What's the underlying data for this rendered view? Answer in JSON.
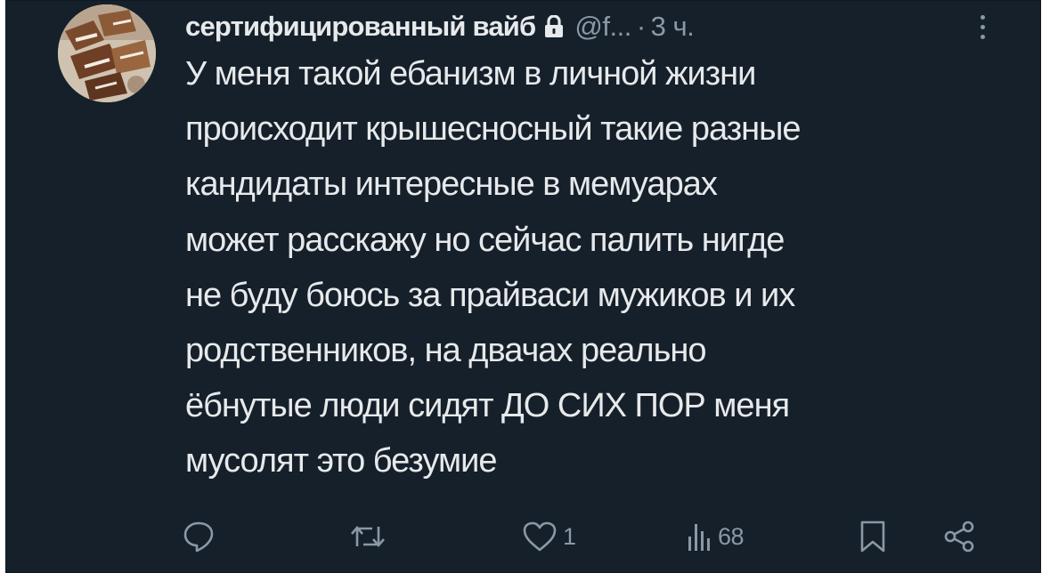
{
  "tweet": {
    "author_name": "сертифицированный вайб",
    "author_handle": "@f...",
    "separator": "·",
    "time": "3 ч.",
    "text": "У меня такой ебанизм в личной жизни\nпроисходит крышесносный такие разные\nкандидаты интересные в мемуарах\nможет расскажу но сейчас палить нигде\nне буду боюсь за прайваси мужиков и их\nродственников, на двачах реально\nёбнутые люди сидят ДО СИХ ПОР меня\nмусолят это безумие"
  },
  "icons": {
    "lock": "lock-icon",
    "more": "more-vertical-icon",
    "reply": "reply-icon",
    "retweet": "retweet-icon",
    "like": "heart-icon",
    "views": "views-chart-icon",
    "bookmark": "bookmark-icon",
    "share": "share-icon"
  },
  "actions": {
    "reply_count": "",
    "retweet_count": "",
    "like_count": "1",
    "views_count": "68"
  },
  "colors": {
    "background": "#15202b",
    "text_primary": "#e7e9ea",
    "text_secondary": "#8b98a5"
  }
}
